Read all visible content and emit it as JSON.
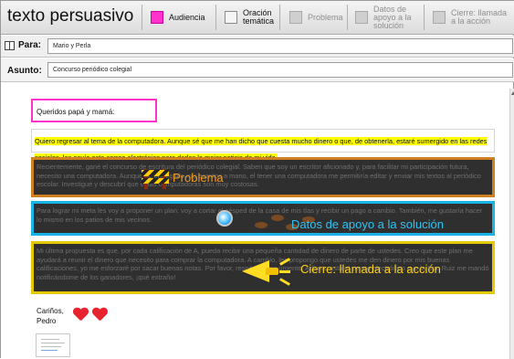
{
  "app": {
    "title": "texto persuasivo"
  },
  "toolbar": {
    "toggles": [
      {
        "label": "Audiencia",
        "active": true
      },
      {
        "label": "Oración temática",
        "active": false
      },
      {
        "label": "Problema",
        "active": false
      },
      {
        "label": "Datos de apoyo a la solución",
        "active": false
      },
      {
        "label": "Cierre: llamada a la acción",
        "active": false
      }
    ]
  },
  "header": {
    "to_label": "Para:",
    "to_value": "Mario y Perla",
    "subject_label": "Asunto:",
    "subject_value": "Concurso periódico colegial"
  },
  "doc": {
    "greeting": "Queridos papá y mamá:",
    "hook": "Quiero regresar al tema de la computadora. Aunque sé que me han dicho que cuesta mucho dinero o que, de obtenerla, estaré sumergido en las redes sociales, les envío este correo electrónico para darles la mejor noticia de mi vida.",
    "problem_text": "Recientemente, gané el concurso de escritura del periódico colegial. Saben que soy un escritor aficionado y, para facilitar mi participación futura, necesito una computadora. Aunque he entregado mis escritos a mano, el tener una computadora me permitiría editar y enviar mis textos al periódico escolar. Investigué y descubrí que estas computadoras son muy costosas.",
    "problem_label": "Problema",
    "support_text": "Para lograr mi meta les voy a proponer un plan: voy a cortar el césped de la casa de mis tías y recibir un pago a cambio. También, me gustaría hacer lo mismo en los patios de mis vecinos.",
    "support_label": "Datos de apoyo a la solución",
    "closing_text": "Mi última propuesta es que, por cada calificación de A, pueda recibir una pequeña cantidad de dinero de parte de ustedes. Creo que este plan me ayudará a reunir el dinero que necesito para comprar la computadora. A cambio, les propongo que ustedes me den dinero por mis buenas calificaciones, yo me esforzaré por sacar buenas notas. Por favor, respóndanme urgente. Adjunto está el correo electrónico que la Sra. Ruiz me mandó notificándome de los ganadores, ¡qué extraño!",
    "closing_label": "Cierre: llamada a la acción",
    "signoff": "Cariños,",
    "signature": "Pedro"
  },
  "colors": {
    "audiencia": "#ff33cc",
    "problema": "#d08020",
    "apoyo": "#1ab3e6",
    "cierre": "#e4c800",
    "hook_highlight": "#ffff00"
  },
  "icons": [
    "book-icon",
    "barrier-icon",
    "footsteps-icon",
    "magnifier-icon",
    "megaphone-icon",
    "heart-icon"
  ]
}
